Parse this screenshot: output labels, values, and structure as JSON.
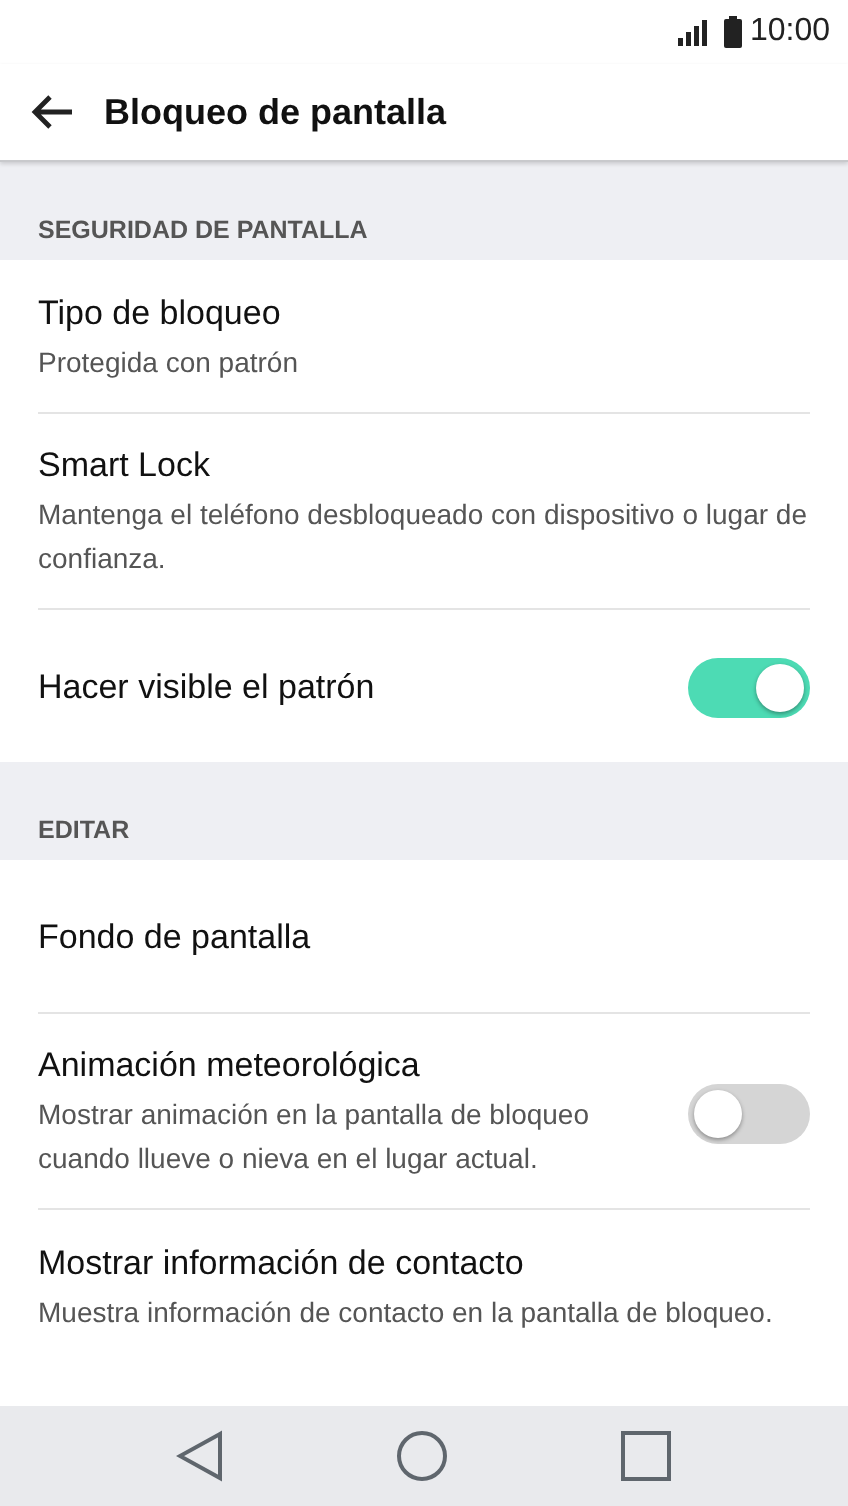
{
  "status_bar": {
    "time": "10:00"
  },
  "header": {
    "title": "Bloqueo de pantalla"
  },
  "sections": [
    {
      "title": "SEGURIDAD DE PANTALLA",
      "items": [
        {
          "kind": "plain",
          "title": "Tipo de bloqueo",
          "subtitle": "Protegida con patrón"
        },
        {
          "kind": "plain",
          "title": "Smart Lock",
          "subtitle": "Mantenga el teléfono desbloqueado con dispositivo o lugar de confianza."
        },
        {
          "kind": "toggle",
          "title": "Hacer visible el patrón",
          "on": true
        }
      ]
    },
    {
      "title": "EDITAR",
      "items": [
        {
          "kind": "plain",
          "title": "Fondo de pantalla"
        },
        {
          "kind": "toggle",
          "title": "Animación meteorológica",
          "subtitle": "Mostrar animación en la pantalla de bloqueo cuando llueve o nieva en el lugar actual.",
          "on": false
        },
        {
          "kind": "plain",
          "title": "Mostrar información de contacto",
          "subtitle": "Muestra información de contacto en la pantalla de bloqueo."
        }
      ]
    }
  ]
}
